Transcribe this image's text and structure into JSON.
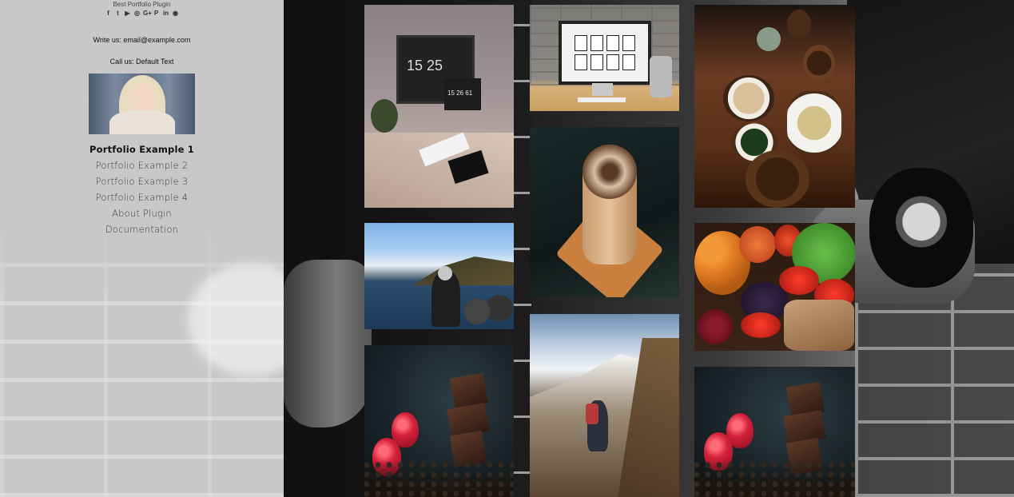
{
  "sidebar": {
    "site_title": "Best Portfolio Plugin",
    "social_icons": [
      "facebook-icon",
      "twitter-icon",
      "youtube-icon",
      "instagram-icon",
      "google-plus-icon",
      "pinterest-icon",
      "linkedin-icon",
      "github-icon"
    ],
    "social_glyphs": [
      "f",
      "t",
      "▶",
      "◎",
      "G+",
      "P",
      "in",
      "◉"
    ],
    "write_us": "Write us: email@example.com",
    "call_us": "Call us: Default Text",
    "avatar_alt": "profile-photo",
    "menu": [
      {
        "label": "Portfolio Example 1",
        "active": true
      },
      {
        "label": "Portfolio Example 2",
        "active": false
      },
      {
        "label": "Portfolio Example 3",
        "active": false
      },
      {
        "label": "Portfolio Example 4",
        "active": false
      },
      {
        "label": "About Plugin",
        "active": false
      },
      {
        "label": "Documentation",
        "active": false
      }
    ]
  },
  "gallery": {
    "items": [
      {
        "name": "desk-workspace-image",
        "screen_text_1": "15 25",
        "screen_text_2": "15 26 61"
      },
      {
        "name": "imac-desk-image"
      },
      {
        "name": "food-bowls-image"
      },
      {
        "name": "lake-mountain-image"
      },
      {
        "name": "coffee-cup-image"
      },
      {
        "name": "mountain-hiker-image"
      },
      {
        "name": "vegetables-image"
      },
      {
        "name": "chocolate-raspberry-image"
      },
      {
        "name": "chocolate-raspberry-image-2"
      }
    ]
  },
  "colors": {
    "sidebar_bg": "#d6d6d6",
    "menu_active": "#111111",
    "menu_text": "#3c3c3c",
    "page_bg": "#111111"
  }
}
